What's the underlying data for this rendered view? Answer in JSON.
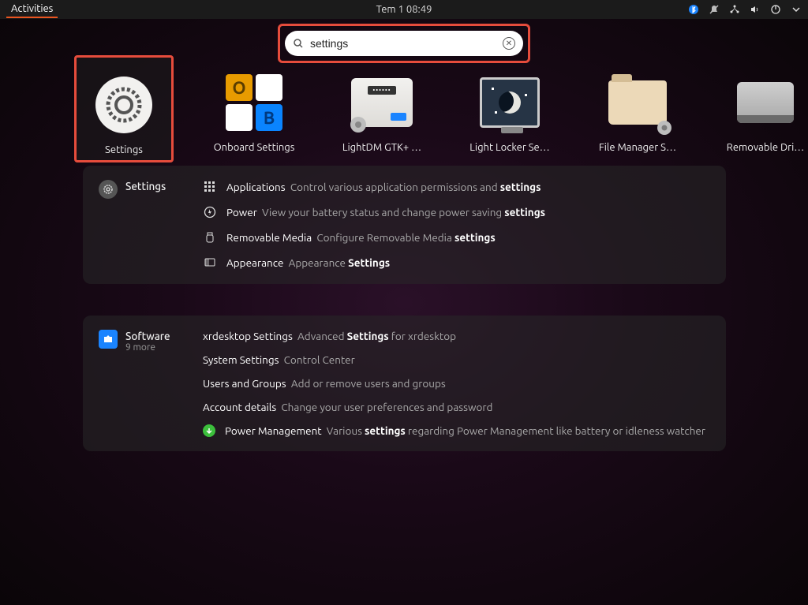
{
  "topbar": {
    "activities": "Activities",
    "datetime": "Tem 1  08:49"
  },
  "search": {
    "value": "settings"
  },
  "apps": [
    {
      "label": "Settings"
    },
    {
      "label": "Onboard Settings"
    },
    {
      "label": "LightDM GTK+ …"
    },
    {
      "label": "Light Locker Se…"
    },
    {
      "label": "File Manager S…"
    },
    {
      "label": "Removable Dri…"
    }
  ],
  "settings_section": {
    "title": "Settings",
    "items": [
      {
        "name": "Applications",
        "desc_pre": "Control various application permissions and ",
        "desc_hl": "settings"
      },
      {
        "name": "Power",
        "desc_pre": "View your battery status and change power saving ",
        "desc_hl": "settings"
      },
      {
        "name": "Removable Media",
        "desc_pre": "Configure Removable Media ",
        "desc_hl": "settings"
      },
      {
        "name": "Appearance",
        "desc_pre": "Appearance ",
        "desc_hl": "Settings"
      }
    ]
  },
  "software_section": {
    "title": "Software",
    "subtitle": "9 more",
    "items": [
      {
        "name": "xrdesktop Settings",
        "desc_pre": "Advanced ",
        "desc_hl": "Settings",
        "desc_post": " for xrdesktop"
      },
      {
        "name": "System Settings",
        "desc_pre": "Control Center",
        "desc_hl": "",
        "desc_post": ""
      },
      {
        "name": "Users and Groups",
        "desc_pre": "Add or remove users and groups",
        "desc_hl": "",
        "desc_post": ""
      },
      {
        "name": "Account details",
        "desc_pre": "Change your user preferences and password",
        "desc_hl": "",
        "desc_post": ""
      },
      {
        "name": "Power Management",
        "desc_pre": "Various ",
        "desc_hl": "settings",
        "desc_post": " regarding Power Management like battery or idleness watcher"
      }
    ]
  }
}
